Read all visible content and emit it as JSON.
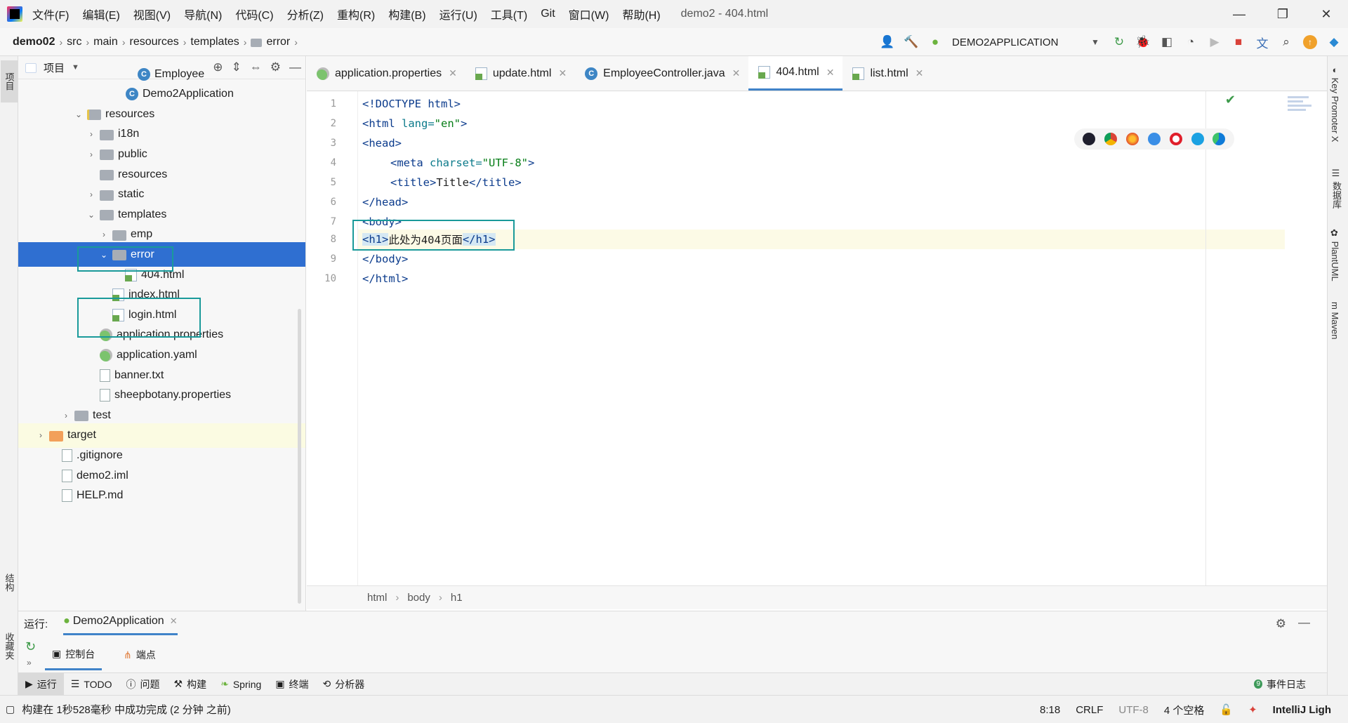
{
  "app": {
    "window_title": "demo2 - 404.html",
    "menu": [
      "文件(F)",
      "编辑(E)",
      "视图(V)",
      "导航(N)",
      "代码(C)",
      "分析(Z)",
      "重构(R)",
      "构建(B)",
      "运行(U)",
      "工具(T)",
      "Git",
      "窗口(W)",
      "帮助(H)"
    ],
    "window_buttons": {
      "minimize": "—",
      "maximize": "❐",
      "close": "✕"
    }
  },
  "navbar": {
    "crumbs": [
      "demo02",
      "src",
      "main",
      "resources",
      "templates",
      "error"
    ],
    "run_config": "DEMO2APPLICATION"
  },
  "left_strip": {
    "project": "项目",
    "structure": "结构",
    "favorites": "收藏夹"
  },
  "project": {
    "title": "项目",
    "rows": [
      {
        "label": "Employee",
        "icon": "class-icon",
        "indent": 150,
        "arrow": ""
      },
      {
        "label": "Demo2Application",
        "icon": "spring-class-icon",
        "indent": 133,
        "arrow": ""
      },
      {
        "label": "resources",
        "icon": "resources-folder-icon",
        "indent": 78,
        "arrow": "⌄"
      },
      {
        "label": "i18n",
        "icon": "folder-icon",
        "indent": 96,
        "arrow": "›"
      },
      {
        "label": "public",
        "icon": "folder-icon",
        "indent": 96,
        "arrow": "›"
      },
      {
        "label": "resources",
        "icon": "folder-icon",
        "indent": 96,
        "arrow": ""
      },
      {
        "label": "static",
        "icon": "folder-icon",
        "indent": 96,
        "arrow": "›"
      },
      {
        "label": "templates",
        "icon": "folder-icon",
        "indent": 96,
        "arrow": "⌄"
      },
      {
        "label": "emp",
        "icon": "folder-icon",
        "indent": 114,
        "arrow": "›"
      },
      {
        "label": "error",
        "icon": "folder-icon",
        "indent": 114,
        "arrow": "⌄",
        "selected": true
      },
      {
        "label": "404.html",
        "icon": "html-file-icon",
        "indent": 132,
        "arrow": ""
      },
      {
        "label": "index.html",
        "icon": "html-file-icon",
        "indent": 114,
        "arrow": ""
      },
      {
        "label": "login.html",
        "icon": "html-file-icon",
        "indent": 114,
        "arrow": ""
      },
      {
        "label": "application.properties",
        "icon": "spring-config-icon",
        "indent": 96,
        "arrow": ""
      },
      {
        "label": "application.yaml",
        "icon": "spring-config-icon",
        "indent": 96,
        "arrow": ""
      },
      {
        "label": "banner.txt",
        "icon": "text-file-icon",
        "indent": 96,
        "arrow": ""
      },
      {
        "label": "sheepbotany.properties",
        "icon": "properties-file-icon",
        "indent": 96,
        "arrow": ""
      },
      {
        "label": "test",
        "icon": "folder-icon",
        "indent": 60,
        "arrow": "›"
      },
      {
        "label": "target",
        "icon": "target-folder-icon",
        "indent": 24,
        "arrow": "›",
        "highlight": true
      },
      {
        "label": ".gitignore",
        "icon": "text-file-icon",
        "indent": 42,
        "arrow": ""
      },
      {
        "label": "demo2.iml",
        "icon": "text-file-icon",
        "indent": 42,
        "arrow": ""
      },
      {
        "label": "HELP.md",
        "icon": "text-file-icon",
        "indent": 42,
        "arrow": ""
      }
    ]
  },
  "tabs": [
    {
      "label": "application.properties",
      "icon": "spring-config-icon",
      "active": false
    },
    {
      "label": "update.html",
      "icon": "html-file-icon",
      "active": false
    },
    {
      "label": "EmployeeController.java",
      "icon": "class-icon",
      "active": false
    },
    {
      "label": "404.html",
      "icon": "html-file-icon",
      "active": true
    },
    {
      "label": "list.html",
      "icon": "html-file-icon",
      "active": false
    }
  ],
  "editor": {
    "line_numbers": [
      "1",
      "2",
      "3",
      "4",
      "5",
      "6",
      "7",
      "8",
      "9",
      "10"
    ],
    "code": {
      "l1": "<!DOCTYPE html>",
      "l2a": "<html ",
      "l2b": "lang=",
      "l2c": "\"en\"",
      "l2d": ">",
      "l3": "<head>",
      "l4a": "<meta ",
      "l4b": "charset=",
      "l4c": "\"UTF-8\"",
      "l4d": ">",
      "l5a": "<title>",
      "l5b": "Title",
      "l5c": "</title>",
      "l6": "</head>",
      "l7": "<body>",
      "l8a": "<h1>",
      "l8b": "此处为404页面",
      "l8c": "</h1>",
      "l9": "</body>",
      "l10": "</html>"
    },
    "breadcrumb": [
      "html",
      "body",
      "h1"
    ]
  },
  "right_strip": {
    "key_promoter": "Key Promoter X",
    "database": "数据库",
    "plantuml": "PlantUML",
    "maven": "Maven"
  },
  "run_panel": {
    "label": "运行:",
    "config": "Demo2Application",
    "console": "控制台",
    "endpoints": "端点"
  },
  "tool_windows": [
    "运行",
    "TODO",
    "问题",
    "构建",
    "Spring",
    "终端",
    "分析器"
  ],
  "event_log": "事件日志",
  "status": {
    "message": "构建在 1秒528毫秒 中成功完成 (2 分钟 之前)",
    "position": "8:18",
    "line_sep": "CRLF",
    "encoding": "UTF-8",
    "indent": "4 个空格",
    "theme": "IntelliJ Ligh"
  },
  "colors": {
    "accent": "#2f6fd1",
    "highlight_box": "#1a9a9a",
    "tag": "#0b3b8c",
    "string": "#067d17"
  }
}
